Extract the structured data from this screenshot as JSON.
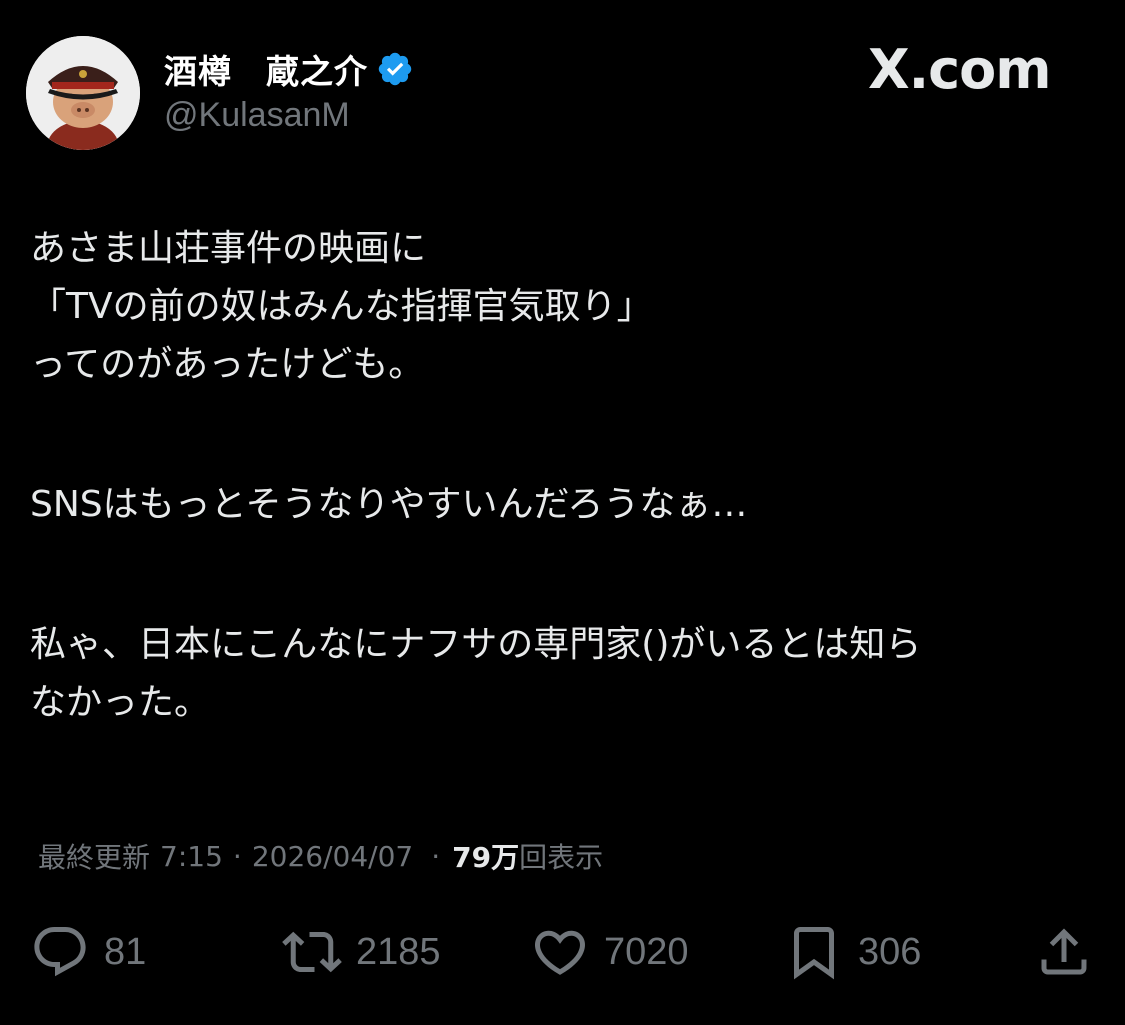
{
  "author": {
    "display_name": "酒樽　蔵之介",
    "handle": "@KulasanM",
    "verified": true,
    "avatar_icon": "pig-officer-avatar"
  },
  "brand": "X.com",
  "tweet": {
    "lines": [
      "あさま山荘事件の映画に",
      "「TVの前の奴はみんな指揮官気取り」",
      "ってのがあったけども。",
      "",
      "SNSはもっとそうなりやすいんだろうなぁ…",
      "",
      "私ゃ、日本にこんなにナフサの専門家()がいるとは知ら",
      "なかった。"
    ]
  },
  "meta": {
    "label": "最終更新",
    "time": "7:15",
    "date": "2026/04/07",
    "views_count": "79万",
    "views_label": "回表示"
  },
  "actions": {
    "replies": "81",
    "reposts": "2185",
    "likes": "7020",
    "bookmarks": "306"
  },
  "colors": {
    "background": "#000000",
    "text": "#e7e9ea",
    "secondary": "#71767b",
    "verified": "#1d9bf0"
  }
}
